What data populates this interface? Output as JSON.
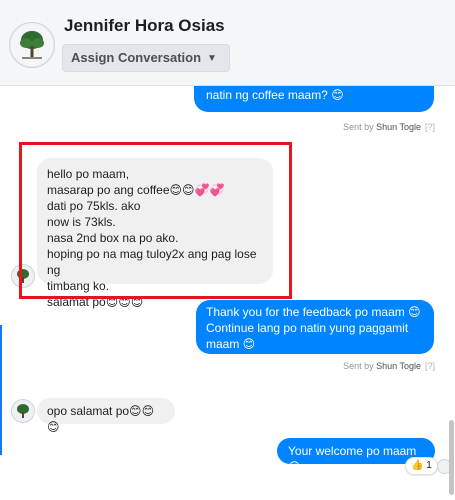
{
  "header": {
    "contact_name": "Jennifer Hora Osias",
    "assign_label": "Assign Conversation",
    "assign_icon": "caret-down-icon"
  },
  "messages": {
    "out1_text": "natin ng coffee maam? 😊",
    "sent_by_prefix": "Sent by ",
    "agent": "Shun Togle",
    "help_mark": "[?]",
    "in1_lines": [
      "hello po maam,",
      "masarap po ang coffee😊😊💞💞",
      "dati po 75kls. ako",
      "now is 73kls.",
      "nasa 2nd box na po ako.",
      "hoping po na mag tuloy2x ang pag lose ng",
      "timbang ko.",
      "salamat po😊😊😊"
    ],
    "out2_lines": [
      "Thank you for the feedback po maam 😊",
      "Continue lang po natin yung paggamit",
      "maam 😊"
    ],
    "in2_text": "opo salamat po😊😊😊",
    "out3_text": "Your welcome po maam 😊",
    "reaction_emoji": "👍",
    "reaction_count": "1"
  },
  "colors": {
    "outgoing": "#0084ff",
    "incoming": "#f1f0f0",
    "highlight": "#e8141d"
  }
}
